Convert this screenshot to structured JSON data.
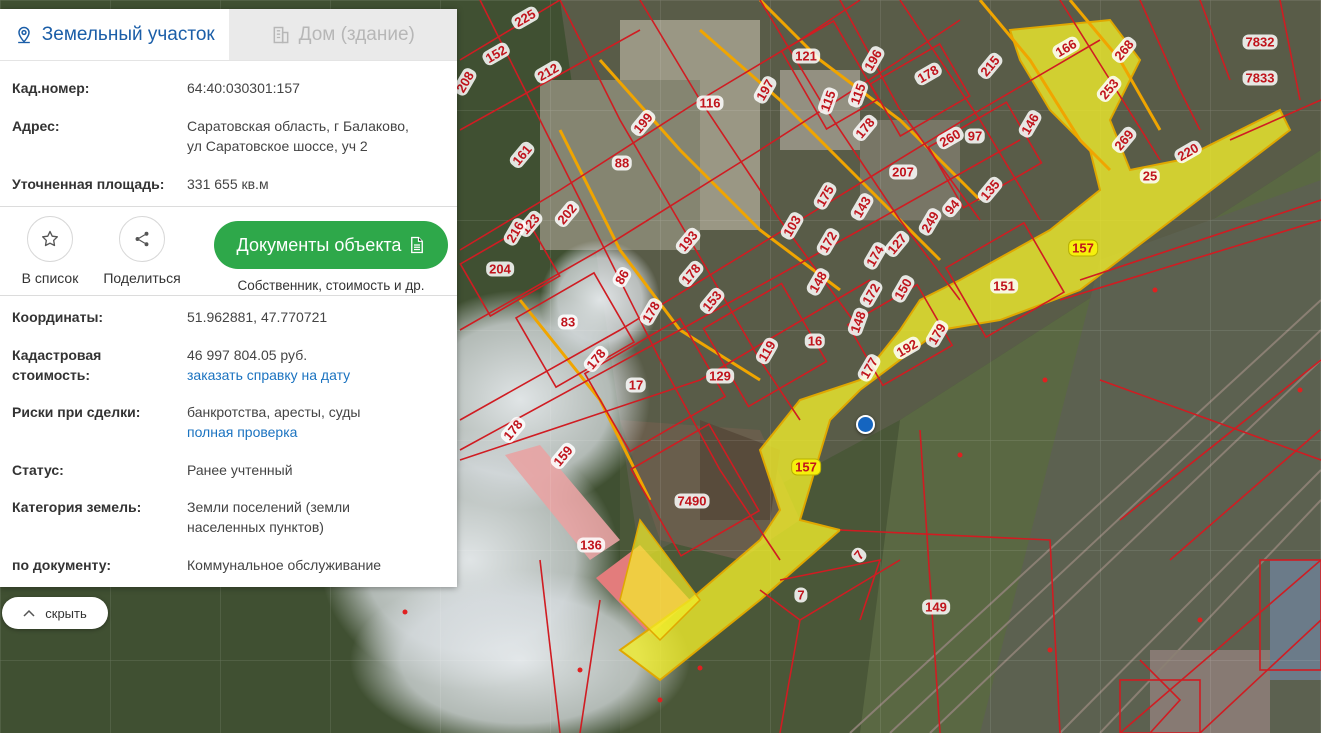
{
  "tabs": {
    "land": "Земельный участок",
    "building": "Дом (здание)"
  },
  "info": {
    "cadnum_label": "Кад.номер:",
    "cadnum_value": "64:40:030301:157",
    "address_label": "Адрес:",
    "address_line1": "Саратовская область, г Балаково,",
    "address_line2": "ул Саратовское шоссе, уч 2",
    "area_label": "Уточненная площадь:",
    "area_value": "331 655 кв.м"
  },
  "actions": {
    "list_label": "В список",
    "share_label": "Поделиться",
    "docs_button": "Документы объекта",
    "docs_sub": "Собственник, стоимость и др."
  },
  "details": {
    "coords_label": "Координаты:",
    "coords_value": "51.962881, 47.770721",
    "cost_label_1": "Кадастровая",
    "cost_label_2": "стоимость:",
    "cost_value": "46 997 804.05 руб.",
    "cost_link": "заказать справку на дату",
    "risks_label": "Риски при сделки:",
    "risks_value": "банкротства, аресты, суды",
    "risks_link": "полная проверка",
    "status_label": "Статус:",
    "status_value": "Ранее учтенный",
    "category_label": "Категория земель:",
    "category_line1": "Земли поселений (земли",
    "category_line2": "населенных пунктов)",
    "bydoc_label": "по документу:",
    "bydoc_value": "Коммунальное обслуживание"
  },
  "hide_button": "скрыть",
  "map": {
    "parcel_labels": [
      "225",
      "152",
      "212",
      "208",
      "121",
      "196",
      "178",
      "215",
      "166",
      "268",
      "7832",
      "7833",
      "116",
      "197",
      "115",
      "115",
      "253",
      "199",
      "146",
      "260",
      "97",
      "269",
      "220",
      "161",
      "88",
      "178",
      "207",
      "25",
      "202",
      "123",
      "216",
      "103",
      "175",
      "143",
      "94",
      "249",
      "135",
      "204",
      "193",
      "172",
      "174",
      "127",
      "157",
      "178",
      "86",
      "153",
      "148",
      "150",
      "151",
      "178",
      "83",
      "16",
      "148",
      "172",
      "179",
      "119",
      "192",
      "178",
      "17",
      "129",
      "177",
      "178",
      "159",
      "157",
      "7490",
      "136",
      "7",
      "7",
      "149"
    ],
    "selected_parcel": "157",
    "colors": {
      "satellite_bg": "#4d5a3a",
      "parcel_border": "#d01c22",
      "selected_fill": "#f3ef2a",
      "marker": "#1565c0"
    }
  }
}
